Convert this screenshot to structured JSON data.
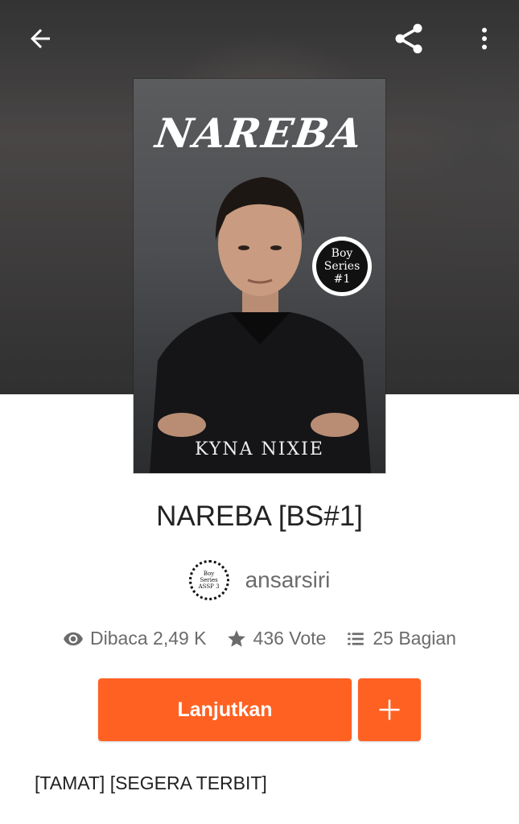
{
  "header": {
    "back_icon": "arrow-left-icon",
    "share_icon": "share-icon",
    "more_icon": "more-vertical-icon"
  },
  "cover": {
    "title": "NAREBA",
    "author": "KYNA NIXIE",
    "badge": [
      "Boy",
      "Series",
      "#1"
    ]
  },
  "story": {
    "title": "NAREBA [BS#1]",
    "author_name": "ansarsiri",
    "avatar_text": [
      "Boy",
      "Series",
      "ASSP 3"
    ]
  },
  "stats": {
    "reads": "Dibaca 2,49 K",
    "votes": "436 Vote",
    "parts": "25 Bagian"
  },
  "actions": {
    "continue_label": "Lanjutkan",
    "add_icon": "plus-icon"
  },
  "description": {
    "tagline": "[TAMAT] [SEGERA TERBIT]"
  },
  "colors": {
    "accent": "#ff6122",
    "text_primary": "#222222",
    "text_secondary": "#6b6b6b"
  }
}
